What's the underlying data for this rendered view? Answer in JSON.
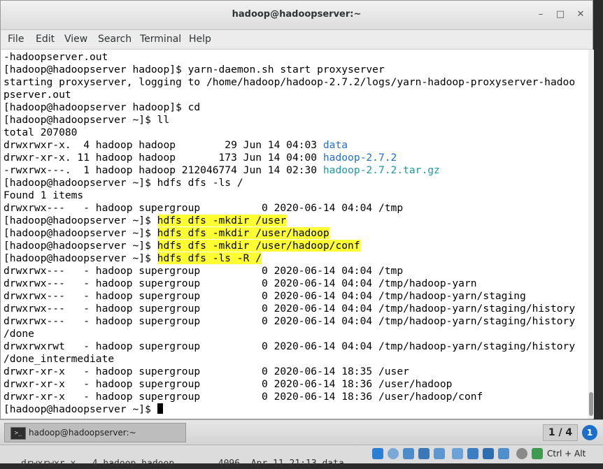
{
  "window": {
    "title": "hadoop@hadoopserver:~"
  },
  "window_buttons": {
    "minimize": "–",
    "maximize": "□",
    "close": "✕"
  },
  "menu": [
    "File",
    "Edit",
    "View",
    "Search",
    "Terminal",
    "Help"
  ],
  "terminal_lines": [
    {
      "parts": [
        {
          "t": "-hadoopserver.out"
        }
      ]
    },
    {
      "parts": [
        {
          "t": "[hadoop@hadoopserver hadoop]$ yarn-daemon.sh start proxyserver"
        }
      ]
    },
    {
      "parts": [
        {
          "t": "starting proxyserver, logging to /home/hadoop/hadoop-2.7.2/logs/yarn-hadoop-proxyserver-hadoo"
        }
      ]
    },
    {
      "parts": [
        {
          "t": "pserver.out"
        }
      ]
    },
    {
      "parts": [
        {
          "t": "[hadoop@hadoopserver hadoop]$ cd"
        }
      ]
    },
    {
      "parts": [
        {
          "t": "[hadoop@hadoopserver ~]$ ll"
        }
      ]
    },
    {
      "parts": [
        {
          "t": "total 207080"
        }
      ]
    },
    {
      "parts": [
        {
          "t": "drwxrwxr-x.  4 hadoop hadoop        29 Jun 14 04:03 "
        },
        {
          "t": "data",
          "c": "blue"
        }
      ]
    },
    {
      "parts": [
        {
          "t": "drwxr-xr-x. 11 hadoop hadoop       173 Jun 14 04:00 "
        },
        {
          "t": "hadoop-2.7.2",
          "c": "blue"
        }
      ]
    },
    {
      "parts": [
        {
          "t": "-rwxrwx---.  1 hadoop hadoop 212046774 Jun 14 02:30 "
        },
        {
          "t": "hadoop-2.7.2.tar.gz",
          "c": "cyan"
        }
      ]
    },
    {
      "parts": [
        {
          "t": "[hadoop@hadoopserver ~]$ hdfs dfs -ls /"
        }
      ]
    },
    {
      "parts": [
        {
          "t": "Found 1 items"
        }
      ]
    },
    {
      "parts": [
        {
          "t": "drwxrwx---   - hadoop supergroup          0 2020-06-14 04:04 /tmp"
        }
      ]
    },
    {
      "parts": [
        {
          "t": "[hadoop@hadoopserver ~]$ "
        },
        {
          "t": "hdfs dfs -mkdir /user",
          "c": "hl"
        }
      ]
    },
    {
      "parts": [
        {
          "t": "[hadoop@hadoopserver ~]$ "
        },
        {
          "t": "hdfs dfs -mkdir /user/hadoop",
          "c": "hl"
        }
      ]
    },
    {
      "parts": [
        {
          "t": "[hadoop@hadoopserver ~]$ "
        },
        {
          "t": "hdfs dfs -mkdir /user/hadoop/conf",
          "c": "hl"
        }
      ]
    },
    {
      "parts": [
        {
          "t": "[hadoop@hadoopserver ~]$ "
        },
        {
          "t": "hdfs dfs -ls -R /",
          "c": "hl"
        }
      ]
    },
    {
      "parts": [
        {
          "t": "drwxrwx---   - hadoop supergroup          0 2020-06-14 04:04 /tmp"
        }
      ]
    },
    {
      "parts": [
        {
          "t": "drwxrwx---   - hadoop supergroup          0 2020-06-14 04:04 /tmp/hadoop-yarn"
        }
      ]
    },
    {
      "parts": [
        {
          "t": "drwxrwx---   - hadoop supergroup          0 2020-06-14 04:04 /tmp/hadoop-yarn/staging"
        }
      ]
    },
    {
      "parts": [
        {
          "t": "drwxrwx---   - hadoop supergroup          0 2020-06-14 04:04 /tmp/hadoop-yarn/staging/history"
        }
      ]
    },
    {
      "parts": [
        {
          "t": "drwxrwx---   - hadoop supergroup          0 2020-06-14 04:04 /tmp/hadoop-yarn/staging/history"
        }
      ]
    },
    {
      "parts": [
        {
          "t": "/done"
        }
      ]
    },
    {
      "parts": [
        {
          "t": "drwxrwxrwt   - hadoop supergroup          0 2020-06-14 04:04 /tmp/hadoop-yarn/staging/history"
        }
      ]
    },
    {
      "parts": [
        {
          "t": "/done_intermediate"
        }
      ]
    },
    {
      "parts": [
        {
          "t": "drwxr-xr-x   - hadoop supergroup          0 2020-06-14 18:35 /user"
        }
      ]
    },
    {
      "parts": [
        {
          "t": "drwxr-xr-x   - hadoop supergroup          0 2020-06-14 18:36 /user/hadoop"
        }
      ]
    },
    {
      "parts": [
        {
          "t": "drwxr-xr-x   - hadoop supergroup          0 2020-06-14 18:36 /user/hadoop/conf"
        }
      ]
    },
    {
      "parts": [
        {
          "t": "[hadoop@hadoopserver ~]$ "
        }
      ],
      "cursor": true
    }
  ],
  "taskbar": {
    "task_label": "hadoop@hadoopserver:~",
    "task_icon_text": ">_",
    "pager": "1 / 4",
    "notification": "1"
  },
  "vm_statusbar": {
    "host_key": "Ctrl + Alt"
  },
  "background_text": "drwxrwxr-x.  4 hadoop hadoop        4096  Apr 11 21:13 data",
  "colors": {
    "highlight": "#ffff33",
    "dir_blue": "#1f6fd0",
    "archive_cyan": "#1c9a9a"
  }
}
